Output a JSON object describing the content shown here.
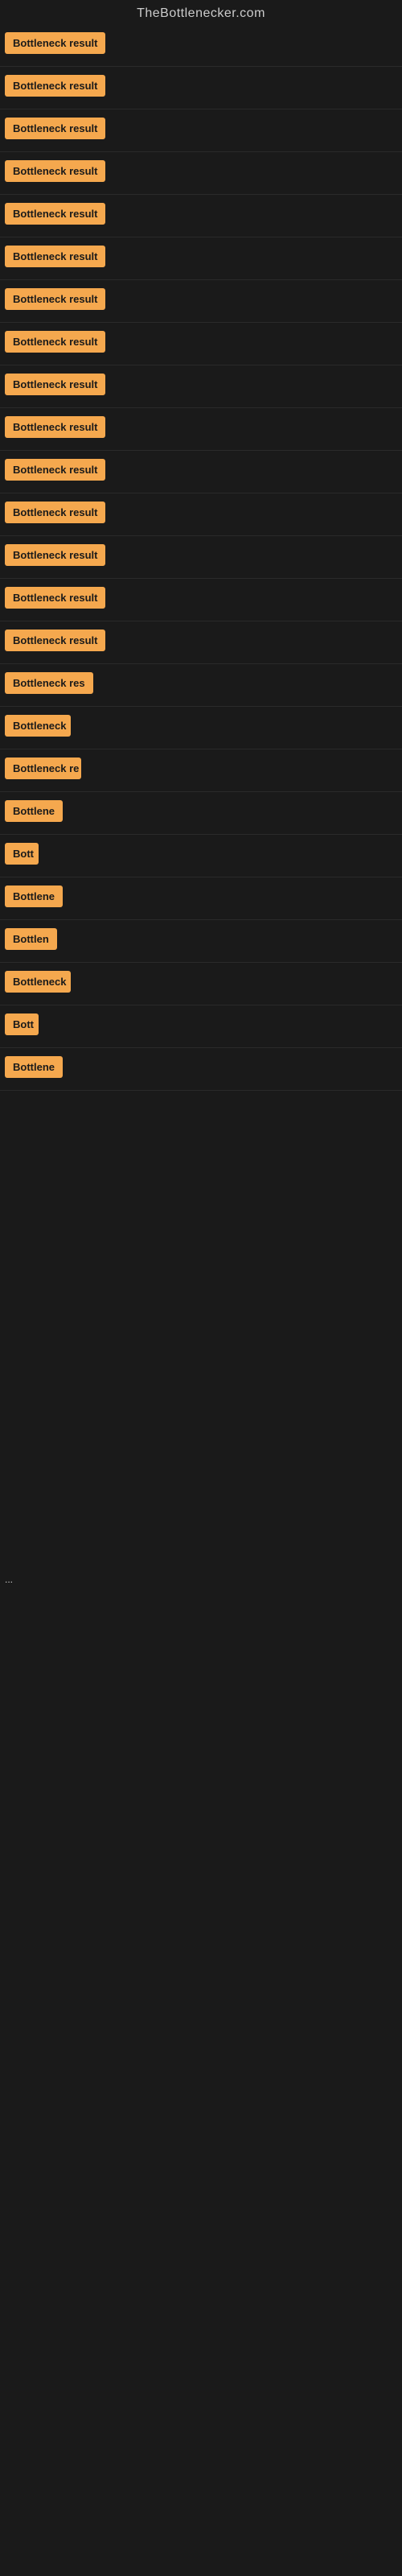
{
  "site": {
    "title": "TheBottlenecker.com"
  },
  "results": [
    {
      "id": 1,
      "label": "Bottleneck result",
      "width": 130
    },
    {
      "id": 2,
      "label": "Bottleneck result",
      "width": 130
    },
    {
      "id": 3,
      "label": "Bottleneck result",
      "width": 130
    },
    {
      "id": 4,
      "label": "Bottleneck result",
      "width": 130
    },
    {
      "id": 5,
      "label": "Bottleneck result",
      "width": 130
    },
    {
      "id": 6,
      "label": "Bottleneck result",
      "width": 130
    },
    {
      "id": 7,
      "label": "Bottleneck result",
      "width": 130
    },
    {
      "id": 8,
      "label": "Bottleneck result",
      "width": 130
    },
    {
      "id": 9,
      "label": "Bottleneck result",
      "width": 130
    },
    {
      "id": 10,
      "label": "Bottleneck result",
      "width": 130
    },
    {
      "id": 11,
      "label": "Bottleneck result",
      "width": 130
    },
    {
      "id": 12,
      "label": "Bottleneck result",
      "width": 130
    },
    {
      "id": 13,
      "label": "Bottleneck result",
      "width": 130
    },
    {
      "id": 14,
      "label": "Bottleneck result",
      "width": 130
    },
    {
      "id": 15,
      "label": "Bottleneck result",
      "width": 130
    },
    {
      "id": 16,
      "label": "Bottleneck res",
      "width": 110
    },
    {
      "id": 17,
      "label": "Bottleneck",
      "width": 82
    },
    {
      "id": 18,
      "label": "Bottleneck re",
      "width": 95
    },
    {
      "id": 19,
      "label": "Bottlene",
      "width": 72
    },
    {
      "id": 20,
      "label": "Bott",
      "width": 42
    },
    {
      "id": 21,
      "label": "Bottlene",
      "width": 72
    },
    {
      "id": 22,
      "label": "Bottlen",
      "width": 65
    },
    {
      "id": 23,
      "label": "Bottleneck",
      "width": 82
    },
    {
      "id": 24,
      "label": "Bott",
      "width": 42
    },
    {
      "id": 25,
      "label": "Bottlene",
      "width": 72
    }
  ],
  "footer": {
    "ellipsis": "..."
  }
}
